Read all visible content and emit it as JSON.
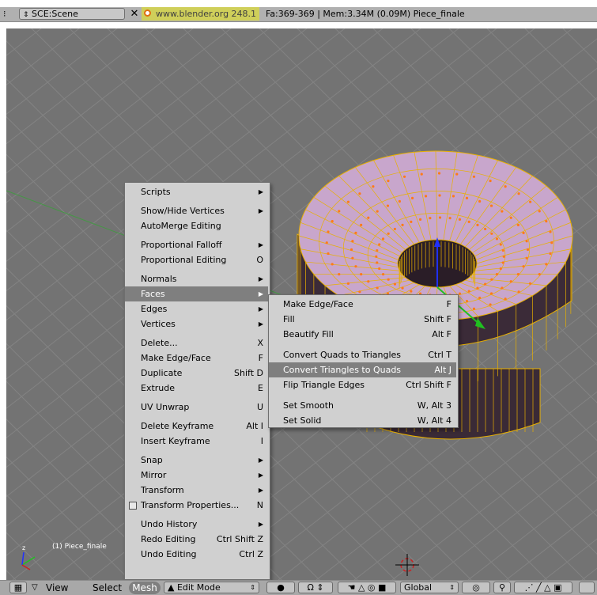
{
  "topbar": {
    "scene": "SCE:Scene",
    "close": "✕",
    "url": "www.blender.org 248.1",
    "stats": "Fa:369-369 | Mem:3.34M (0.09M) Piece_finale"
  },
  "viewport": {
    "object_label": "(1) Piece_finale"
  },
  "mesh_menu": {
    "items": [
      {
        "label": "Scripts",
        "shortcut": "",
        "submenu": true
      },
      {
        "label": "Show/Hide Vertices",
        "shortcut": "",
        "submenu": true
      },
      {
        "label": "AutoMerge Editing",
        "shortcut": "",
        "submenu": false
      },
      {
        "label": "Proportional Falloff",
        "shortcut": "",
        "submenu": true
      },
      {
        "label": "Proportional Editing",
        "shortcut": "O",
        "submenu": false
      },
      {
        "label": "Normals",
        "shortcut": "",
        "submenu": true
      },
      {
        "label": "Faces",
        "shortcut": "",
        "submenu": true,
        "active": true
      },
      {
        "label": "Edges",
        "shortcut": "",
        "submenu": true
      },
      {
        "label": "Vertices",
        "shortcut": "",
        "submenu": true
      },
      {
        "label": "Delete...",
        "shortcut": "X",
        "submenu": false
      },
      {
        "label": "Make Edge/Face",
        "shortcut": "F",
        "submenu": false
      },
      {
        "label": "Duplicate",
        "shortcut": "Shift D",
        "submenu": false
      },
      {
        "label": "Extrude",
        "shortcut": "E",
        "submenu": false
      },
      {
        "label": "UV Unwrap",
        "shortcut": "U",
        "submenu": false
      },
      {
        "label": "Delete Keyframe",
        "shortcut": "Alt I",
        "submenu": false
      },
      {
        "label": "Insert Keyframe",
        "shortcut": "I",
        "submenu": false
      },
      {
        "label": "Snap",
        "shortcut": "",
        "submenu": true
      },
      {
        "label": "Mirror",
        "shortcut": "",
        "submenu": true
      },
      {
        "label": "Transform",
        "shortcut": "",
        "submenu": true
      },
      {
        "label": "Transform Properties...",
        "shortcut": "N",
        "submenu": false,
        "checkbox": true
      },
      {
        "label": "Undo History",
        "shortcut": "",
        "submenu": true
      },
      {
        "label": "Redo Editing",
        "shortcut": "Ctrl Shift Z",
        "submenu": false
      },
      {
        "label": "Undo Editing",
        "shortcut": "Ctrl Z",
        "submenu": false
      }
    ]
  },
  "faces_submenu": {
    "items": [
      {
        "label": "Make Edge/Face",
        "shortcut": "F"
      },
      {
        "label": "Fill",
        "shortcut": "Shift F"
      },
      {
        "label": "Beautify Fill",
        "shortcut": "Alt F"
      },
      {
        "label": "Convert Quads to Triangles",
        "shortcut": "Ctrl T"
      },
      {
        "label": "Convert Triangles to Quads",
        "shortcut": "Alt J",
        "active": true
      },
      {
        "label": "Flip Triangle Edges",
        "shortcut": "Ctrl Shift F"
      },
      {
        "label": "Set Smooth",
        "shortcut": "W, Alt 3"
      },
      {
        "label": "Set Solid",
        "shortcut": "W, Alt 4"
      }
    ]
  },
  "bottombar": {
    "view": "View",
    "select": "Select",
    "mesh": "Mesh",
    "mode": "Edit Mode",
    "orientation": "Global"
  },
  "colors": {
    "viewport_bg": "#737373",
    "menu_bg": "#d0d0d0",
    "menu_active": "#7f7f7f",
    "mesh_face": "#c8a6cc",
    "mesh_side": "#3a2a36",
    "mesh_wire": "#e8b000",
    "vertex": "#ff7a1a"
  }
}
